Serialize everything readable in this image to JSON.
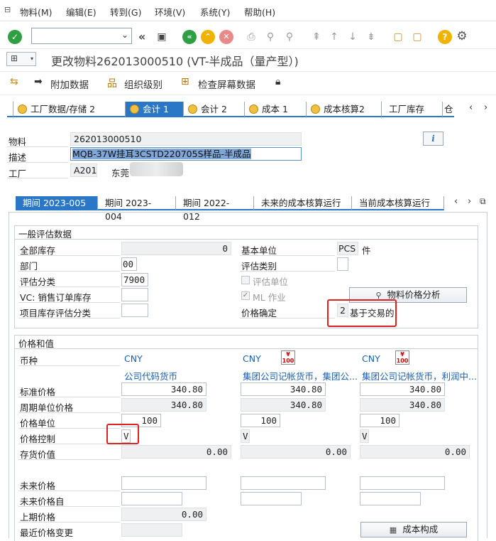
{
  "menu": {
    "items": [
      "物料(M)",
      "编辑(E)",
      "转到(G)",
      "环境(V)",
      "系统(Y)",
      "帮助(H)"
    ]
  },
  "window": {
    "title": "更改物料262013000510 (VT-半成品（量产型）)"
  },
  "app_toolbar": {
    "additional_data": "附加数据",
    "org_levels": "组织级别",
    "check_screen_data": "检查屏幕数据"
  },
  "tabs": [
    "工厂数据/存储 2",
    "会计 1",
    "会计 2",
    "成本 1",
    "成本核算2",
    "工厂库存",
    "仓"
  ],
  "header": {
    "material_label": "物料",
    "material_value": "262013000510",
    "desc_label": "描述",
    "desc_value": "MQB-37W挂耳3CSTD220705S样品-半成品",
    "plant_label": "工厂",
    "plant_value": "A201",
    "plant_name": "东莞"
  },
  "period_tabs": [
    "期间 2023-005",
    "期间 2023-004",
    "期间 2022-012",
    "未来的成本核算运行",
    "当前成本核算运行"
  ],
  "general": {
    "title": "一般评估数据",
    "total_stock_label": "全部库存",
    "total_stock_value": "0",
    "dept_label": "部门",
    "dept_value": "00",
    "val_class_label": "评估分类",
    "val_class_value": "7900",
    "vc_label": "VC: 销售订单库存",
    "proj_label": "项目库存评估分类",
    "base_unit_label": "基本单位",
    "base_unit_value": "PCS",
    "base_unit_text": "件",
    "val_cat_label": "评估类别",
    "val_unit_label": "评估单位",
    "ml_label": "ML 作业",
    "price_det_label": "价格确定",
    "price_det_value": "2",
    "price_det_text": "基于交易的",
    "analysis_button": "物料价格分析"
  },
  "prices": {
    "title": "价格和值",
    "currency_label": "币种",
    "currencies": [
      "CNY",
      "CNY",
      "CNY"
    ],
    "currency_types": [
      "公司代码货币",
      "集团公司记帐货币，集团公...",
      "集团公司记帐货币，利润中..."
    ],
    "std_price_label": "标准价格",
    "std_prices": [
      "340.80",
      "340.80",
      "340.80"
    ],
    "per_unit_label": "周期单位价格",
    "per_unit_prices": [
      "340.80",
      "340.80",
      "340.80"
    ],
    "price_unit_label": "价格单位",
    "price_units": [
      "100",
      "100",
      "100"
    ],
    "price_ctrl_label": "价格控制",
    "price_ctrl": [
      "V",
      "V",
      "V"
    ],
    "inv_value_label": "存货价值",
    "inv_values": [
      "0.00",
      "0.00",
      "0.00"
    ],
    "future_price_label": "未来价格",
    "future_from_label": "未来价格自",
    "prev_price_label": "上期价格",
    "prev_price_value": "0.00",
    "last_change_label": "最近价格变更",
    "cost_comp_button": "成本构成"
  },
  "colors": {
    "accent": "#2a77c7",
    "highlight": "#e02020",
    "ok": "#2ea043",
    "warn": "#f0b400",
    "cancel": "#e06060"
  }
}
